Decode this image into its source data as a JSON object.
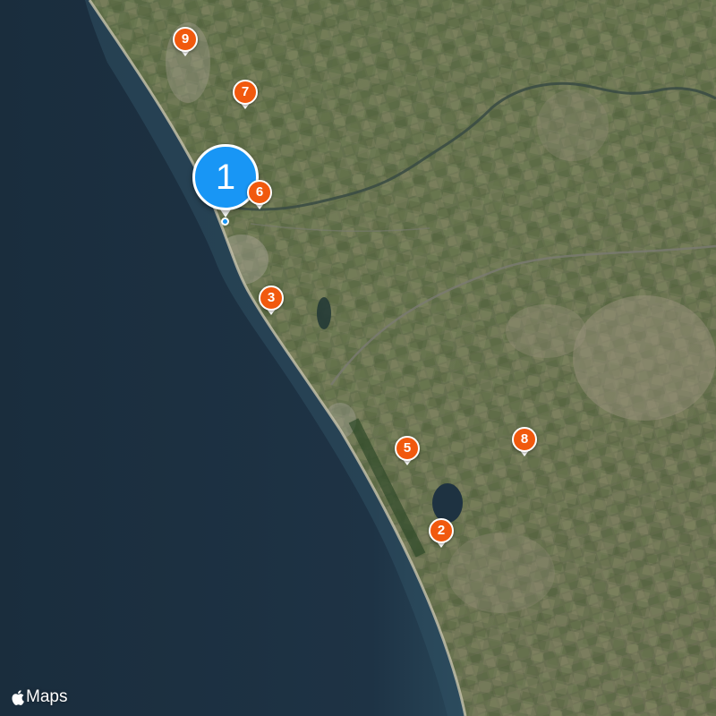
{
  "attribution": {
    "brand_icon": "apple-icon",
    "label": "Maps"
  },
  "colors": {
    "sea": "#1c2f3f",
    "land": "#5d6f48",
    "pin_orange": "#f1590e",
    "pin_blue": "#1896f5"
  },
  "markers": [
    {
      "label": "1",
      "kind": "selected"
    },
    {
      "label": "2",
      "kind": "normal"
    },
    {
      "label": "3",
      "kind": "normal"
    },
    {
      "label": "5",
      "kind": "normal"
    },
    {
      "label": "6",
      "kind": "normal"
    },
    {
      "label": "7",
      "kind": "normal"
    },
    {
      "label": "8",
      "kind": "normal"
    },
    {
      "label": "9",
      "kind": "normal"
    }
  ]
}
